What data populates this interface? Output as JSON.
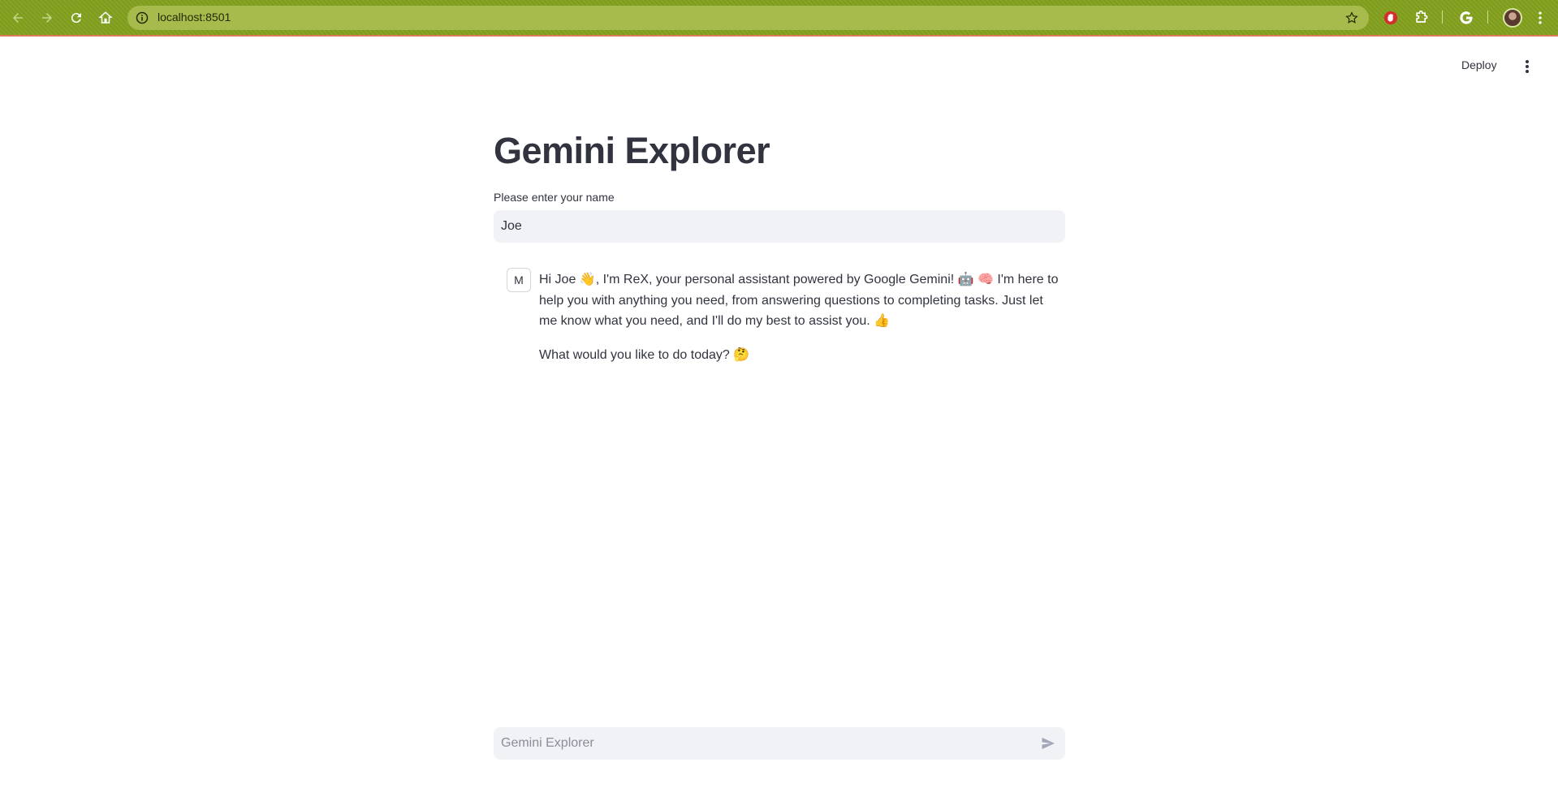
{
  "browser": {
    "url": "localhost:8501"
  },
  "header": {
    "deploy_label": "Deploy"
  },
  "main": {
    "title": "Gemini Explorer",
    "name_field": {
      "label": "Please enter your name",
      "value": "Joe"
    },
    "chat": {
      "avatar_letter": "M",
      "paragraph_1": "Hi Joe 👋, I'm ReX, your personal assistant powered by Google Gemini! 🤖 🧠 I'm here to help you with anything you need, from answering questions to completing tasks. Just let me know what you need, and I'll do my best to assist you. 👍",
      "paragraph_2": "What would you like to do today? 🤔"
    },
    "chat_input": {
      "placeholder": "Gemini Explorer"
    }
  }
}
